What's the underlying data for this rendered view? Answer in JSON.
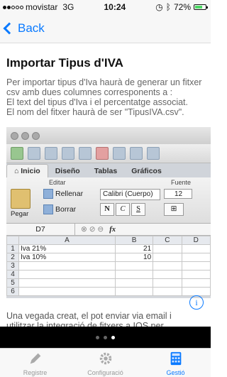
{
  "status_bar": {
    "carrier": "movistar",
    "network": "3G",
    "time": "10:24",
    "battery": "72%",
    "battery_level": 0.72
  },
  "nav": {
    "back_label": "Back"
  },
  "page": {
    "title": "Importar Tipus d'IVA",
    "description": [
      "Per importar tipus d'Iva  haurà de generar un fitxer",
      "csv amb dues columnes corresponents a :",
      "El text del tipus d'Iva i el percentatge associat.",
      "El nom del fitxer haurà de ser \"TipusIVA.csv\"."
    ],
    "footnote": "Una vegada creat, el pot enviar via email i utilitzar la integració de fitxers a IOS per importar-ho a l'aplicació."
  },
  "excel": {
    "tabs": [
      "Inicio",
      "Diseño",
      "Tablas",
      "Gráficos"
    ],
    "group_edit": "Editar",
    "group_font": "Fuente",
    "paste_label": "Pegar",
    "fill_label": "Rellenar",
    "clear_label": "Borrar",
    "font_name": "Calibri (Cuerpo)",
    "font_size": "12",
    "bold": "N",
    "italic": "C",
    "underline": "S",
    "cell_ref": "D7",
    "fx": "fx",
    "columns": [
      "A",
      "B",
      "C",
      "D"
    ],
    "rows": [
      {
        "n": "1",
        "a": "Iva 21%",
        "b": "21"
      },
      {
        "n": "2",
        "a": "Iva 10%",
        "b": "10"
      },
      {
        "n": "3",
        "a": "",
        "b": ""
      },
      {
        "n": "4",
        "a": "",
        "b": ""
      },
      {
        "n": "5",
        "a": "",
        "b": ""
      },
      {
        "n": "6",
        "a": "",
        "b": ""
      }
    ]
  },
  "pager": {
    "count": 3,
    "active": 2
  },
  "tabbar": {
    "items": [
      "Registre",
      "Configuració",
      "Gestió"
    ],
    "active": 2
  },
  "colors": {
    "accent": "#0a7aff"
  }
}
